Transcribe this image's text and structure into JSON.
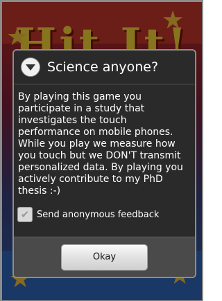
{
  "background": {
    "game_title": "Hit It!",
    "colors": {
      "red": "#c4372a",
      "blue": "#2f66b8",
      "star": "#f2c23b"
    }
  },
  "dialog": {
    "icon": "info-chevron-icon",
    "title": "Science anyone?",
    "message": "By playing this game you participate in a study that investigates the touch performance on mobile phones. While you play we measure how you touch but we DON'T transmit personalized data. By playing you actively contribute to my PhD thesis :-)",
    "checkbox_label": "Send anonymous feedback",
    "checkbox_checked": true,
    "okay_label": "Okay"
  }
}
